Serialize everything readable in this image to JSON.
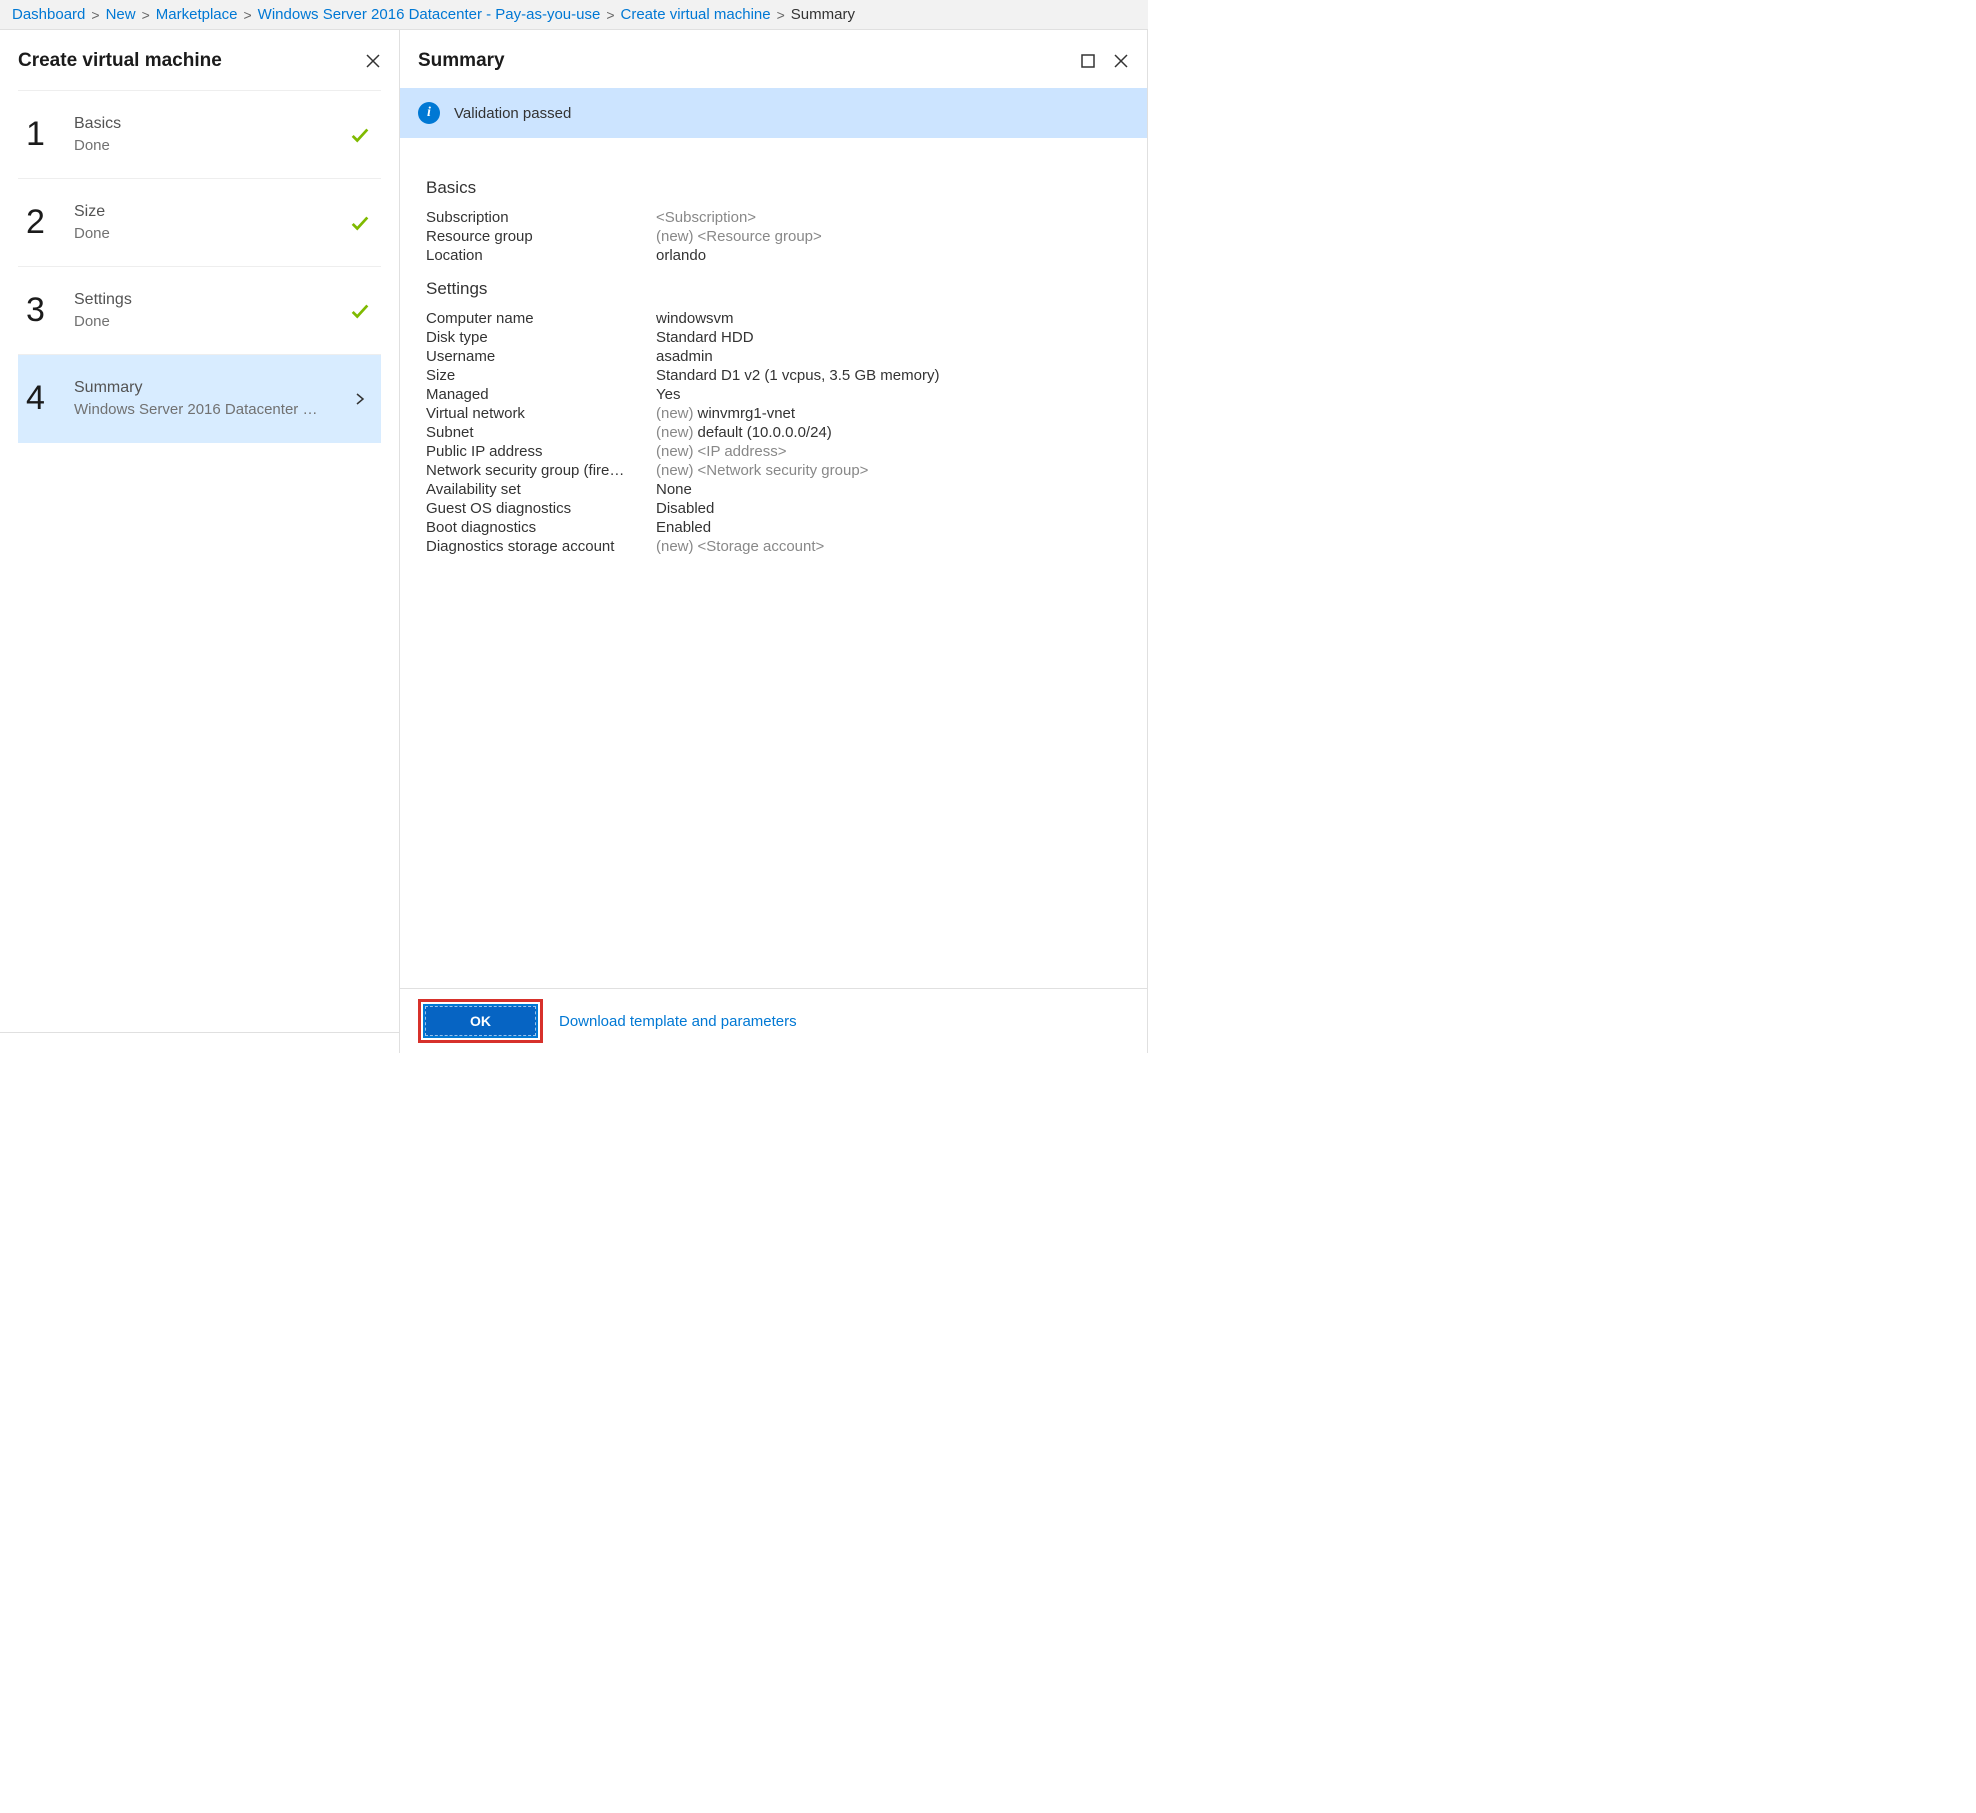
{
  "breadcrumb": {
    "items": [
      {
        "label": "Dashboard",
        "link": true
      },
      {
        "label": "New",
        "link": true
      },
      {
        "label": "Marketplace",
        "link": true
      },
      {
        "label": "Windows Server 2016 Datacenter - Pay-as-you-use",
        "link": true
      },
      {
        "label": "Create virtual machine",
        "link": true
      },
      {
        "label": "Summary",
        "link": false
      }
    ]
  },
  "left_panel": {
    "title": "Create virtual machine",
    "steps": [
      {
        "num": "1",
        "title": "Basics",
        "sub": "Done",
        "state": "done"
      },
      {
        "num": "2",
        "title": "Size",
        "sub": "Done",
        "state": "done"
      },
      {
        "num": "3",
        "title": "Settings",
        "sub": "Done",
        "state": "done"
      },
      {
        "num": "4",
        "title": "Summary",
        "sub": "Windows Server 2016 Datacenter …",
        "state": "current"
      }
    ]
  },
  "right_panel": {
    "title": "Summary",
    "validation_message": "Validation passed",
    "sections": [
      {
        "title": "Basics",
        "rows": [
          {
            "key": "Subscription",
            "prefix": "",
            "value": "<Subscription>",
            "placeholder": true
          },
          {
            "key": "Resource group",
            "prefix": "(new)",
            "value": "<Resource group>",
            "placeholder": true
          },
          {
            "key": "Location",
            "prefix": "",
            "value": "orlando",
            "placeholder": false
          }
        ]
      },
      {
        "title": "Settings",
        "rows": [
          {
            "key": "Computer name",
            "prefix": "",
            "value": "windowsvm",
            "placeholder": false
          },
          {
            "key": "Disk type",
            "prefix": "",
            "value": "Standard HDD",
            "placeholder": false
          },
          {
            "key": "Username",
            "prefix": "",
            "value": "asadmin",
            "placeholder": false
          },
          {
            "key": "Size",
            "prefix": "",
            "value": "Standard D1 v2 (1 vcpus, 3.5 GB memory)",
            "placeholder": false
          },
          {
            "key": "Managed",
            "prefix": "",
            "value": "Yes",
            "placeholder": false
          },
          {
            "key": "Virtual network",
            "prefix": "(new)",
            "value": "winvmrg1-vnet",
            "placeholder": false
          },
          {
            "key": "Subnet",
            "prefix": "(new)",
            "value": "default (10.0.0.0/24)",
            "placeholder": false
          },
          {
            "key": "Public IP address",
            "prefix": "(new)",
            "value": "<IP address>",
            "placeholder": true
          },
          {
            "key": "Network security group (fire…",
            "prefix": "(new)",
            "value": "<Network security group>",
            "placeholder": true
          },
          {
            "key": "Availability set",
            "prefix": "",
            "value": "None",
            "placeholder": false
          },
          {
            "key": "Guest OS diagnostics",
            "prefix": "",
            "value": "Disabled",
            "placeholder": false
          },
          {
            "key": "Boot diagnostics",
            "prefix": "",
            "value": "Enabled",
            "placeholder": false
          },
          {
            "key": "Diagnostics storage account",
            "prefix": "(new)",
            "value": "<Storage account>",
            "placeholder": true
          }
        ]
      }
    ],
    "footer": {
      "ok_label": "OK",
      "download_label": "Download template and parameters"
    }
  }
}
